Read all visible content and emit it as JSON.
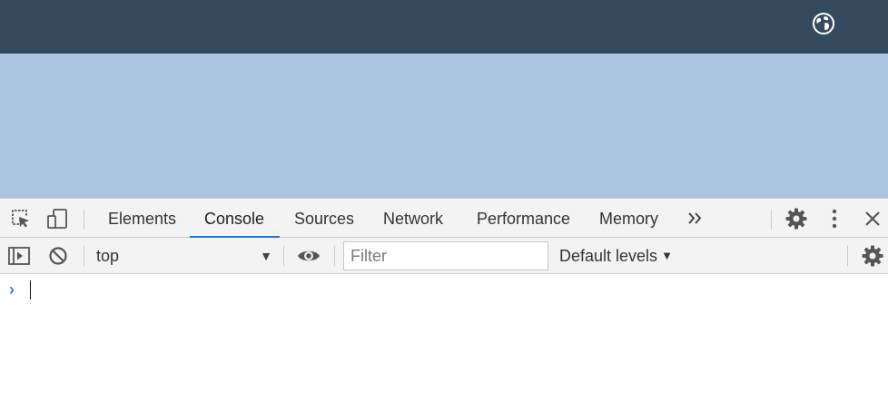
{
  "header": {
    "icon": "globe-icon",
    "background_color": "#344a5f"
  },
  "page": {
    "background_color": "#abc6de"
  },
  "devtools": {
    "tabs": [
      {
        "label": "Elements",
        "active": false
      },
      {
        "label": "Console",
        "active": true
      },
      {
        "label": "Sources",
        "active": false
      },
      {
        "label": "Network",
        "active": false
      },
      {
        "label": "Performance",
        "active": false
      },
      {
        "label": "Memory",
        "active": false
      }
    ],
    "more_tabs_icon": "double-chevron-right-icon",
    "icons": [
      "inspect-element-icon",
      "device-toolbar-icon",
      "gear-icon",
      "kebab-menu-icon",
      "close-icon"
    ],
    "accent_color": "#1a73e8",
    "console_toolbar": {
      "context": "top",
      "filter_placeholder": "Filter",
      "filter_value": "",
      "levels": "Default levels",
      "icons": [
        "sidebar-toggle-icon",
        "clear-console-icon",
        "eye-icon",
        "gear-icon"
      ]
    },
    "prompt": {
      "icon": "prompt-chevron-icon",
      "value": ""
    }
  }
}
